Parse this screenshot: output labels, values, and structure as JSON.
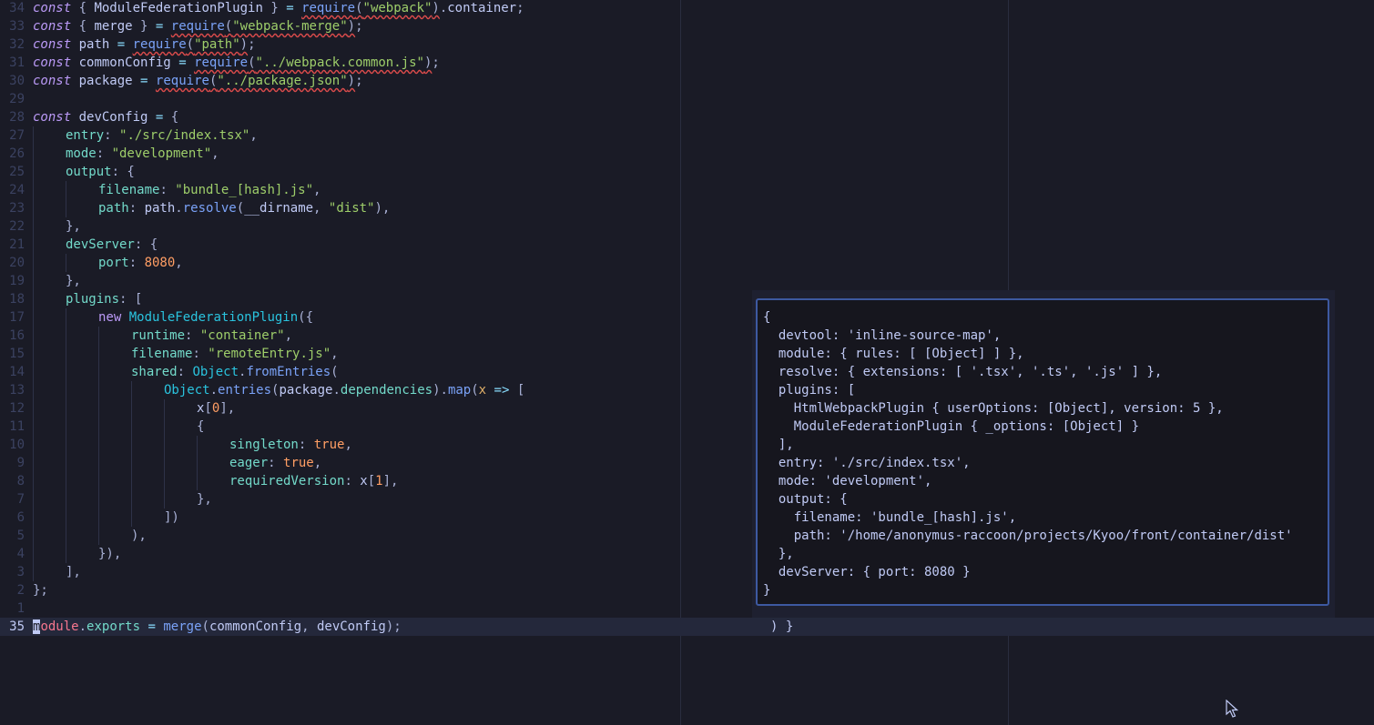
{
  "editor": {
    "lines": [
      {
        "num": "34",
        "indent": 0,
        "tokens": [
          [
            "kw",
            "const"
          ],
          [
            "punc",
            " { "
          ],
          [
            "plain",
            "ModuleFederationPlugin"
          ],
          [
            "punc",
            " } "
          ],
          [
            "op",
            "="
          ],
          [
            "punc",
            " "
          ],
          [
            "fn err",
            "require"
          ],
          [
            "punc err",
            "("
          ],
          [
            "str err",
            "\"webpack\""
          ],
          [
            "punc err",
            ")"
          ],
          [
            "punc",
            "."
          ],
          [
            "plain",
            "container"
          ],
          [
            "punc",
            ";"
          ]
        ]
      },
      {
        "num": "33",
        "indent": 0,
        "tokens": [
          [
            "kw",
            "const"
          ],
          [
            "punc",
            " { "
          ],
          [
            "plain",
            "merge"
          ],
          [
            "punc",
            " } "
          ],
          [
            "op",
            "="
          ],
          [
            "punc",
            " "
          ],
          [
            "fn err",
            "require"
          ],
          [
            "punc err",
            "("
          ],
          [
            "str err",
            "\"webpack-merge\""
          ],
          [
            "punc err",
            ")"
          ],
          [
            "punc",
            ";"
          ]
        ]
      },
      {
        "num": "32",
        "indent": 0,
        "tokens": [
          [
            "kw",
            "const"
          ],
          [
            "punc",
            " "
          ],
          [
            "plain",
            "path"
          ],
          [
            "punc",
            " "
          ],
          [
            "op",
            "="
          ],
          [
            "punc",
            " "
          ],
          [
            "fn err",
            "require"
          ],
          [
            "punc err",
            "("
          ],
          [
            "str err",
            "\"path\""
          ],
          [
            "punc err",
            ")"
          ],
          [
            "punc",
            ";"
          ]
        ]
      },
      {
        "num": "31",
        "indent": 0,
        "tokens": [
          [
            "kw",
            "const"
          ],
          [
            "punc",
            " "
          ],
          [
            "plain",
            "commonConfig"
          ],
          [
            "punc",
            " "
          ],
          [
            "op",
            "="
          ],
          [
            "punc",
            " "
          ],
          [
            "fn err",
            "require"
          ],
          [
            "punc err",
            "("
          ],
          [
            "str err",
            "\"../webpack.common.js\""
          ],
          [
            "punc err",
            ")"
          ],
          [
            "punc",
            ";"
          ]
        ]
      },
      {
        "num": "30",
        "indent": 0,
        "tokens": [
          [
            "kw",
            "const"
          ],
          [
            "punc",
            " "
          ],
          [
            "plain",
            "package"
          ],
          [
            "punc",
            " "
          ],
          [
            "op",
            "="
          ],
          [
            "punc",
            " "
          ],
          [
            "fn err",
            "require"
          ],
          [
            "punc err",
            "("
          ],
          [
            "str err",
            "\"../package.json\""
          ],
          [
            "punc err",
            ")"
          ],
          [
            "punc",
            ";"
          ]
        ]
      },
      {
        "num": "29",
        "indent": 0,
        "tokens": []
      },
      {
        "num": "28",
        "indent": 0,
        "tokens": [
          [
            "kw",
            "const"
          ],
          [
            "punc",
            " "
          ],
          [
            "plain",
            "devConfig"
          ],
          [
            "punc",
            " "
          ],
          [
            "op",
            "="
          ],
          [
            "punc",
            " {"
          ]
        ]
      },
      {
        "num": "27",
        "indent": 1,
        "tokens": [
          [
            "prop",
            "entry"
          ],
          [
            "punc",
            ": "
          ],
          [
            "str",
            "\"./src/index.tsx\""
          ],
          [
            "punc",
            ","
          ]
        ]
      },
      {
        "num": "26",
        "indent": 1,
        "tokens": [
          [
            "prop",
            "mode"
          ],
          [
            "punc",
            ": "
          ],
          [
            "str",
            "\"development\""
          ],
          [
            "punc",
            ","
          ]
        ]
      },
      {
        "num": "25",
        "indent": 1,
        "tokens": [
          [
            "prop",
            "output"
          ],
          [
            "punc",
            ": {"
          ]
        ]
      },
      {
        "num": "24",
        "indent": 2,
        "tokens": [
          [
            "prop",
            "filename"
          ],
          [
            "punc",
            ": "
          ],
          [
            "str",
            "\"bundle_[hash].js\""
          ],
          [
            "punc",
            ","
          ]
        ]
      },
      {
        "num": "23",
        "indent": 2,
        "tokens": [
          [
            "prop",
            "path"
          ],
          [
            "punc",
            ": "
          ],
          [
            "plain",
            "path"
          ],
          [
            "punc",
            "."
          ],
          [
            "fn",
            "resolve"
          ],
          [
            "punc",
            "("
          ],
          [
            "plain",
            "__dirname"
          ],
          [
            "punc",
            ", "
          ],
          [
            "str",
            "\"dist\""
          ],
          [
            "punc",
            "),"
          ]
        ]
      },
      {
        "num": "22",
        "indent": 1,
        "tokens": [
          [
            "punc",
            "},"
          ]
        ]
      },
      {
        "num": "21",
        "indent": 1,
        "tokens": [
          [
            "prop",
            "devServer"
          ],
          [
            "punc",
            ": {"
          ]
        ]
      },
      {
        "num": "20",
        "indent": 2,
        "tokens": [
          [
            "prop",
            "port"
          ],
          [
            "punc",
            ": "
          ],
          [
            "num",
            "8080"
          ],
          [
            "punc",
            ","
          ]
        ]
      },
      {
        "num": "19",
        "indent": 1,
        "tokens": [
          [
            "punc",
            "},"
          ]
        ]
      },
      {
        "num": "18",
        "indent": 1,
        "tokens": [
          [
            "prop",
            "plugins"
          ],
          [
            "punc",
            ": ["
          ]
        ]
      },
      {
        "num": "17",
        "indent": 2,
        "tokens": [
          [
            "kw2",
            "new"
          ],
          [
            "punc",
            " "
          ],
          [
            "cls",
            "ModuleFederationPlugin"
          ],
          [
            "punc",
            "({"
          ]
        ]
      },
      {
        "num": "16",
        "indent": 3,
        "tokens": [
          [
            "prop",
            "runtime"
          ],
          [
            "punc",
            ": "
          ],
          [
            "str",
            "\"container\""
          ],
          [
            "punc",
            ","
          ]
        ]
      },
      {
        "num": "15",
        "indent": 3,
        "tokens": [
          [
            "prop",
            "filename"
          ],
          [
            "punc",
            ": "
          ],
          [
            "str",
            "\"remoteEntry.js\""
          ],
          [
            "punc",
            ","
          ]
        ]
      },
      {
        "num": "14",
        "indent": 3,
        "tokens": [
          [
            "prop",
            "shared"
          ],
          [
            "punc",
            ": "
          ],
          [
            "cls",
            "Object"
          ],
          [
            "punc",
            "."
          ],
          [
            "fn",
            "fromEntries"
          ],
          [
            "punc",
            "("
          ]
        ]
      },
      {
        "num": "13",
        "indent": 4,
        "tokens": [
          [
            "cls",
            "Object"
          ],
          [
            "punc",
            "."
          ],
          [
            "fn",
            "entries"
          ],
          [
            "punc",
            "("
          ],
          [
            "plain",
            "package"
          ],
          [
            "punc",
            "."
          ],
          [
            "prop",
            "dependencies"
          ],
          [
            "punc",
            ")."
          ],
          [
            "fn",
            "map"
          ],
          [
            "punc",
            "("
          ],
          [
            "param",
            "x"
          ],
          [
            "punc",
            " "
          ],
          [
            "op",
            "=>"
          ],
          [
            "punc",
            " ["
          ]
        ]
      },
      {
        "num": "12",
        "indent": 5,
        "tokens": [
          [
            "plain",
            "x"
          ],
          [
            "punc",
            "["
          ],
          [
            "num",
            "0"
          ],
          [
            "punc",
            "],"
          ]
        ]
      },
      {
        "num": "11",
        "indent": 5,
        "tokens": [
          [
            "punc",
            "{"
          ]
        ]
      },
      {
        "num": "10",
        "indent": 6,
        "tokens": [
          [
            "prop",
            "singleton"
          ],
          [
            "punc",
            ": "
          ],
          [
            "num",
            "true"
          ],
          [
            "punc",
            ","
          ]
        ]
      },
      {
        "num": "9",
        "indent": 6,
        "tokens": [
          [
            "prop",
            "eager"
          ],
          [
            "punc",
            ": "
          ],
          [
            "num",
            "true"
          ],
          [
            "punc",
            ","
          ]
        ]
      },
      {
        "num": "8",
        "indent": 6,
        "tokens": [
          [
            "prop",
            "requiredVersion"
          ],
          [
            "punc",
            ": "
          ],
          [
            "plain",
            "x"
          ],
          [
            "punc",
            "["
          ],
          [
            "num",
            "1"
          ],
          [
            "punc",
            "],"
          ]
        ]
      },
      {
        "num": "7",
        "indent": 5,
        "tokens": [
          [
            "punc",
            "},"
          ]
        ]
      },
      {
        "num": "6",
        "indent": 4,
        "tokens": [
          [
            "punc",
            "])"
          ]
        ]
      },
      {
        "num": "5",
        "indent": 3,
        "tokens": [
          [
            "punc",
            "),"
          ]
        ]
      },
      {
        "num": "4",
        "indent": 2,
        "tokens": [
          [
            "punc",
            "}),"
          ]
        ]
      },
      {
        "num": "3",
        "indent": 1,
        "tokens": [
          [
            "punc",
            "],"
          ]
        ]
      },
      {
        "num": "2",
        "indent": 0,
        "tokens": [
          [
            "punc",
            "};"
          ]
        ]
      },
      {
        "num": "1",
        "indent": 0,
        "tokens": []
      },
      {
        "num": "35",
        "indent": 0,
        "current": true,
        "tokens": [
          [
            "cursor",
            "m"
          ],
          [
            "mod",
            "odule"
          ],
          [
            "punc",
            "."
          ],
          [
            "prop",
            "exports"
          ],
          [
            "punc",
            " "
          ],
          [
            "op",
            "="
          ],
          [
            "punc",
            " "
          ],
          [
            "fn",
            "merge"
          ],
          [
            "punc",
            "("
          ],
          [
            "plain",
            "commonConfig"
          ],
          [
            "punc",
            ", "
          ],
          [
            "plain",
            "devConfig"
          ],
          [
            "punc",
            ");"
          ]
        ]
      }
    ],
    "hidden_tail": ") }"
  },
  "popup": {
    "text": "{\n  devtool: 'inline-source-map',\n  module: { rules: [ [Object] ] },\n  resolve: { extensions: [ '.tsx', '.ts', '.js' ] },\n  plugins: [\n    HtmlWebpackPlugin { userOptions: [Object], version: 5 },\n    ModuleFederationPlugin { _options: [Object] }\n  ],\n  entry: './src/index.tsx',\n  mode: 'development',\n  output: {\n    filename: 'bundle_[hash].js',\n    path: '/home/anonymus-raccoon/projects/Kyoo/front/container/dist'\n  },\n  devServer: { port: 8080 }\n}"
  },
  "icons": {
    "cursor": "mouse-pointer-icon"
  },
  "colors": {
    "background": "#1a1b26",
    "popup_border": "#3d59a1"
  }
}
